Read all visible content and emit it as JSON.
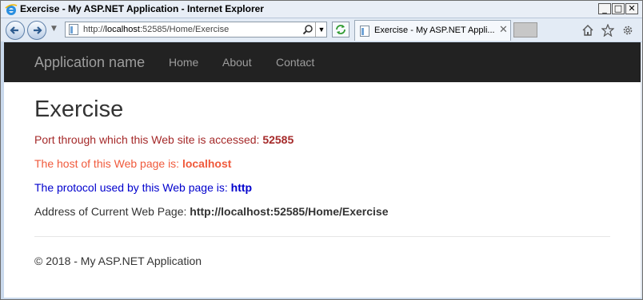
{
  "window": {
    "title": "Exercise - My ASP.NET Application - Internet Explorer",
    "minimize": "_",
    "maximize": "□",
    "close": "✕"
  },
  "addressbar": {
    "url_prefix": "http://",
    "url_host": "localhost",
    "url_rest": ":52585/Home/Exercise"
  },
  "tab": {
    "label": "Exercise - My ASP.NET Appli...",
    "close": "✕"
  },
  "navbar": {
    "brand": "Application name",
    "links": [
      "Home",
      "About",
      "Contact"
    ]
  },
  "content": {
    "heading": "Exercise",
    "port_label": "Port through which this Web site is accessed: ",
    "port_value": "52585",
    "host_label": "The host of this Web page is: ",
    "host_value": "localhost",
    "protocol_label": "The protocol used by this Web page is: ",
    "protocol_value": "http",
    "address_label": "Address of Current Web Page: ",
    "address_value": "http://localhost:52585/Home/Exercise"
  },
  "footer": {
    "text": "© 2018 - My ASP.NET Application"
  },
  "colors": {
    "port": "#a52a2a",
    "host": "#f05a3c",
    "protocol": "#0000cd",
    "address": "#333333"
  },
  "icons": {
    "browser": "ie-logo-icon",
    "back": "back-arrow-icon",
    "forward": "forward-arrow-icon",
    "search": "search-icon",
    "home": "home-icon",
    "favorites": "star-icon",
    "tools": "gear-icon"
  }
}
